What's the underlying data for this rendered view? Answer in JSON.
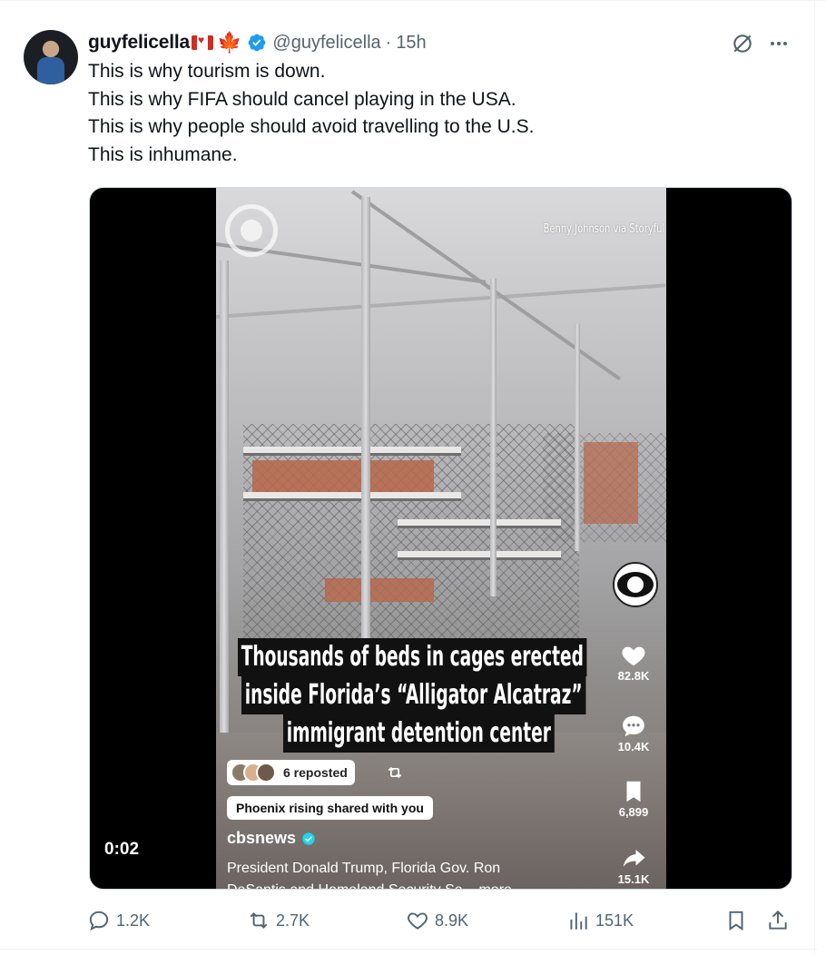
{
  "tweet": {
    "author": {
      "display_name": "guyfelicella",
      "flag_emojis": [
        "canada-flag-icon",
        "maple-leaf-icon"
      ],
      "verified": true,
      "handle": "@guyfelicella",
      "separator": "·",
      "time_ago": "15h"
    },
    "text_lines": [
      "This is why tourism is down.",
      "This is why FIFA should cancel playing in the USA.",
      "This is why people should avoid travelling to the U.S.",
      "This is inhumane."
    ],
    "media": {
      "watermark": "Benny Johnson via Storyful",
      "headline_lines": [
        "Thousands of beds in cages erected",
        "inside Florida’s “Alligator Alcatraz”",
        "immigrant detention center"
      ],
      "reposted_label": "6 reposted",
      "shared_label": "Phoenix rising shared with you",
      "source_handle": "cbsnews",
      "caption_lines": [
        "President Donald Trump, Florida Gov. Ron",
        "DeSantis and Homeland Security Se... more"
      ],
      "side_stats": {
        "likes": "82.8K",
        "comments": "10.4K",
        "bookmarks": "6,899",
        "shares": "15.1K"
      },
      "timestamp": "0:02"
    },
    "actions": {
      "replies": "1.2K",
      "reposts": "2.7K",
      "likes": "8.9K",
      "views": "151K"
    },
    "colors": {
      "text_primary": "#0f1419",
      "text_secondary": "#536471",
      "verified_blue": "#1d9bf0",
      "canada_red": "#d52b1e"
    }
  }
}
